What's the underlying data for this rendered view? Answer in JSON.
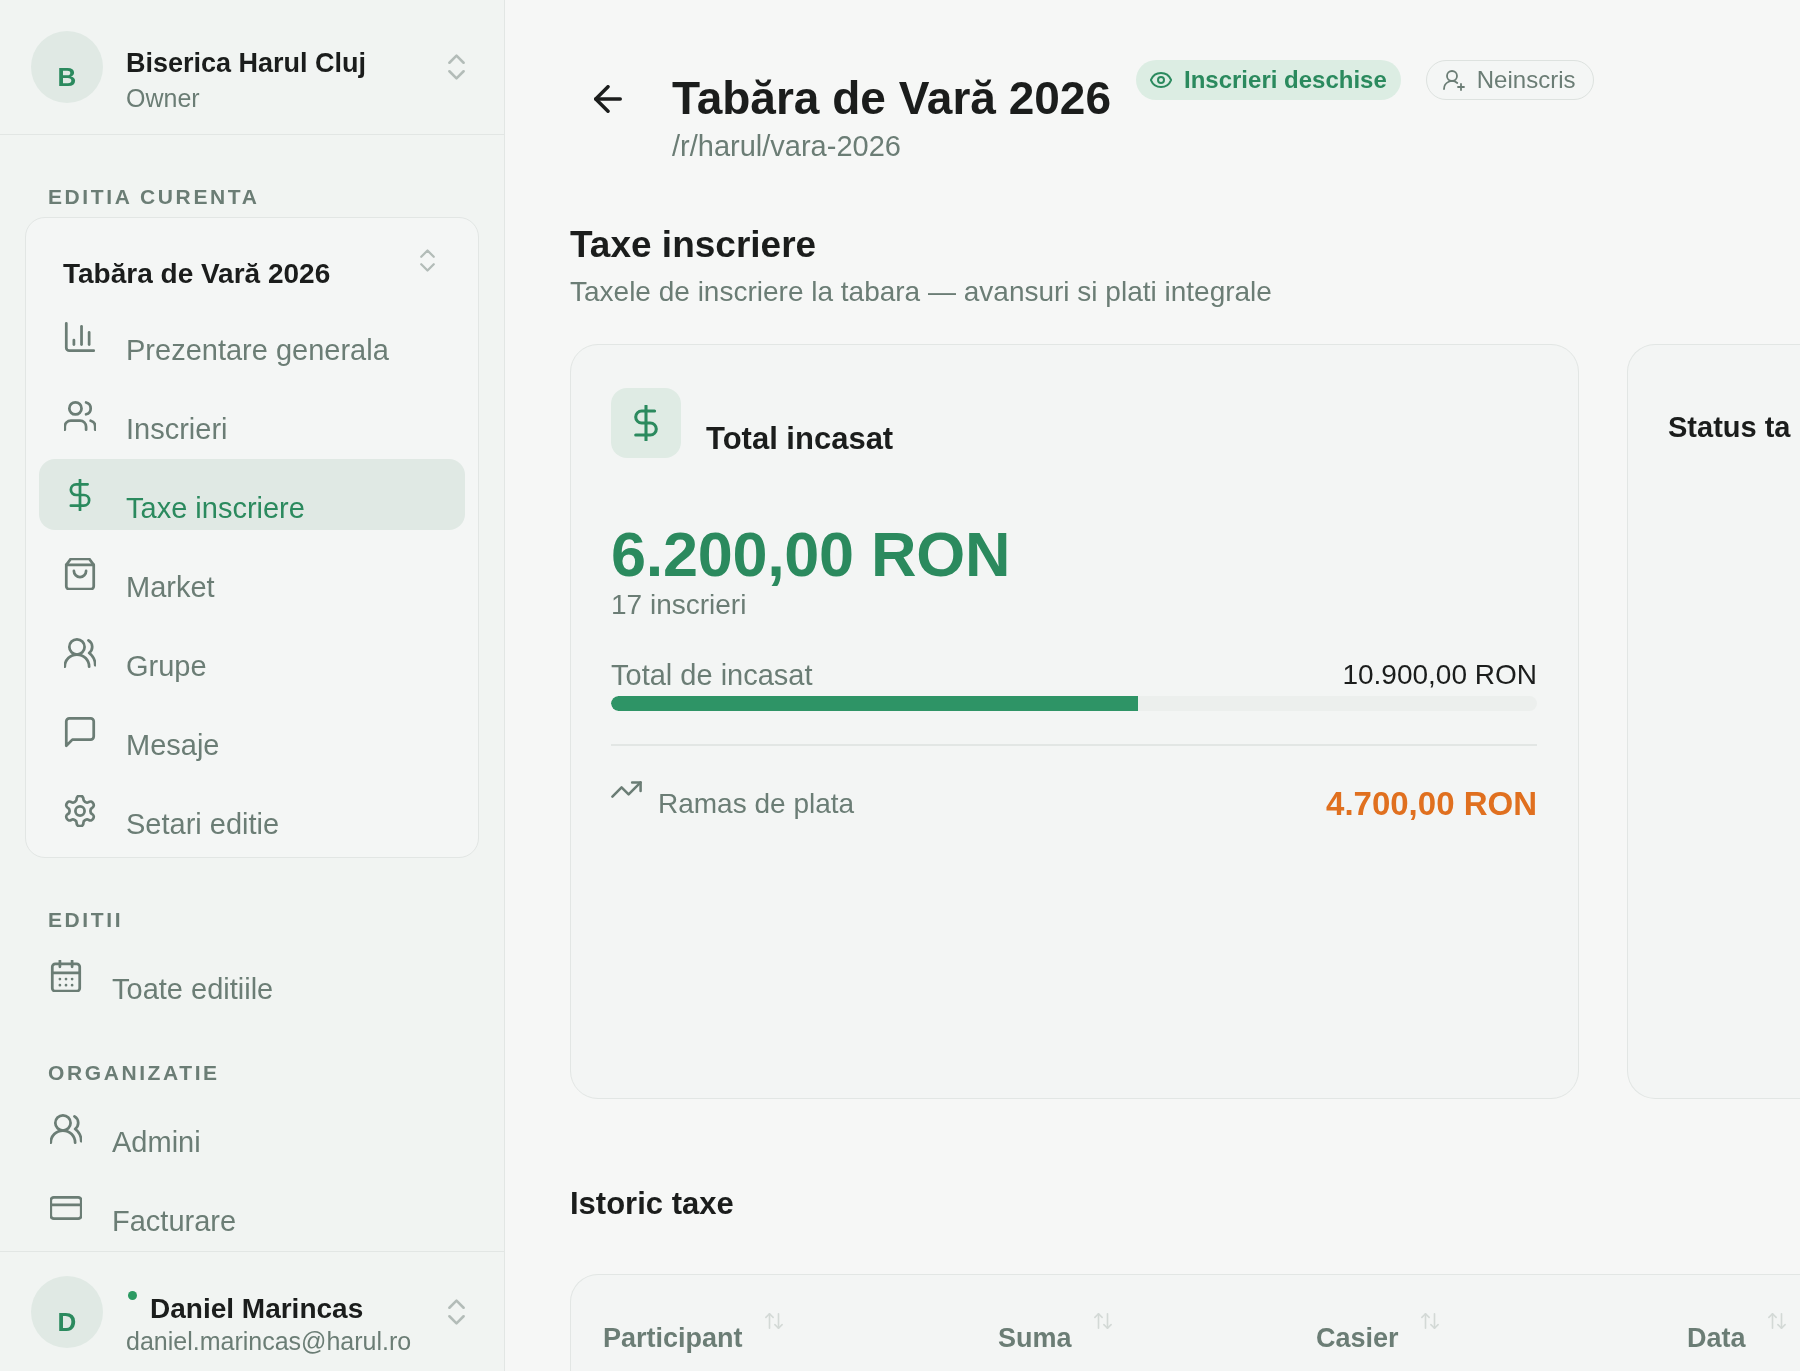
{
  "sidebar": {
    "organization": {
      "initial": "B",
      "name": "Biserica Harul Cluj",
      "role": "Owner"
    },
    "sections": [
      {
        "title": "EDITIA CURENTA",
        "kind": "edition",
        "edition": "Tabăra de Vară 2026",
        "items": [
          {
            "label": "Prezentare generala",
            "selected": false
          },
          {
            "label": "Inscrieri",
            "selected": false
          },
          {
            "label": "Taxe inscriere",
            "selected": true
          },
          {
            "label": "Market",
            "selected": false
          },
          {
            "label": "Grupe",
            "selected": false
          },
          {
            "label": "Mesaje",
            "selected": false
          },
          {
            "label": "Setari editie",
            "selected": false
          }
        ]
      },
      {
        "title": "EDITII",
        "kind": "plain",
        "items": [
          {
            "label": "Toate editiile",
            "selected": false
          }
        ]
      },
      {
        "title": "ORGANIZATIE",
        "kind": "plain",
        "items": [
          {
            "label": "Admini",
            "selected": false
          },
          {
            "label": "Facturare",
            "selected": false
          }
        ]
      }
    ],
    "user": {
      "initial": "D",
      "name": "Daniel Marincas",
      "email": "daniel.marincas@harul.ro",
      "online": true
    }
  },
  "header": {
    "title": "Tabăra de Vară 2026",
    "slug": "/r/harul/vara-2026",
    "badges": [
      {
        "label": "Inscrieri deschise",
        "kind": "open"
      },
      {
        "label": "Neinscris",
        "kind": "enroll"
      }
    ]
  },
  "page": {
    "title": "Taxe inscriere",
    "subtitle": "Taxele de inscriere la tabara — avansuri si plati integrale"
  },
  "cards": [
    {
      "kind": "total",
      "title": "Total incasat",
      "amount": "6.200,00 RON",
      "count": "17 inscrieri",
      "progress": {
        "label": "Total de incasat",
        "value": "10.900,00 RON",
        "level": 0.569
      },
      "remaining": {
        "label": "Ramas de plata",
        "value": "4.700,00 RON"
      }
    },
    {
      "kind": "status",
      "title": "Status ta"
    }
  ],
  "history": {
    "title": "Istoric taxe",
    "columns": [
      "Participant",
      "Suma",
      "Casier",
      "Data"
    ]
  }
}
